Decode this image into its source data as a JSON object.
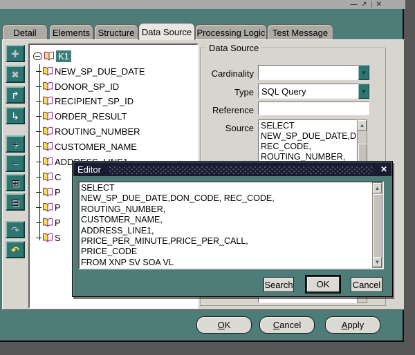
{
  "mdi": {
    "minimize_icon": "—",
    "restore_icon": "↗",
    "close_icon": "✕"
  },
  "tabs": {
    "items": [
      {
        "label": "Detail"
      },
      {
        "label": "Elements"
      },
      {
        "label": "Structure"
      },
      {
        "label": "Data Source"
      },
      {
        "label": "Processing Logic"
      },
      {
        "label": "Test Message"
      }
    ]
  },
  "toolbar": {
    "buttons": [
      {
        "name": "add-node",
        "glyph": "✚"
      },
      {
        "name": "delete-node",
        "glyph": "✖"
      },
      {
        "name": "move-up",
        "glyph": "↱"
      },
      {
        "name": "move-down",
        "glyph": "↳"
      },
      {
        "name": "expand",
        "glyph": "+"
      },
      {
        "name": "collapse",
        "glyph": "−"
      },
      {
        "name": "expand-all",
        "glyph": "⊞"
      },
      {
        "name": "collapse-all",
        "glyph": "⊟"
      },
      {
        "name": "redo",
        "glyph": "↷"
      },
      {
        "name": "undo",
        "glyph": "↶"
      }
    ]
  },
  "tree": {
    "root_label": "K1",
    "items": [
      {
        "label": "NEW_SP_DUE_DATE"
      },
      {
        "label": "DONOR_SP_ID"
      },
      {
        "label": "RECIPIENT_SP_ID"
      },
      {
        "label": "ORDER_RESULT"
      },
      {
        "label": "ROUTING_NUMBER"
      },
      {
        "label": "CUSTOMER_NAME"
      },
      {
        "label": "ADDRESS_LINE1"
      },
      {
        "label": "C"
      },
      {
        "label": "P"
      },
      {
        "label": "P"
      },
      {
        "label": "P"
      },
      {
        "label": "S"
      }
    ]
  },
  "data_source": {
    "legend": "Data Source",
    "cardinality_label": "Cardinality",
    "cardinality_value": "",
    "type_label": "Type",
    "type_value": "SQL Query",
    "reference_label": "Reference",
    "reference_value": "",
    "source_label": "Source",
    "source_text": "SELECT\nNEW_SP_DUE_DATE,DON_CODE,\nREC_CODE,\nROUTING_NUMBER,\nCUSTOMER_NAME,"
  },
  "editor": {
    "title": "Editor",
    "close_icon": "✕",
    "text": "SELECT\nNEW_SP_DUE_DATE,DON_CODE, REC_CODE,\nROUTING_NUMBER,\nCUSTOMER_NAME,\nADDRESS_LINE1,\nPRICE_PER_MINUTE,PRICE_PER_CALL,\nPRICE_CODE\nFROM XNP SV SOA VL",
    "search_label": "Search",
    "ok_label": "OK",
    "cancel_label": "Cancel"
  },
  "footer": {
    "ok_label": "OK",
    "cancel_label": "Cancel",
    "apply_label": "Apply"
  },
  "colors": {
    "window_teal": "#4e7d79",
    "desktop": "#575757",
    "panel": "#d8d5cf",
    "editor_titlebar": "#1a1a31",
    "selection": "#3d7e7a",
    "book_outline": "#8b1f8b"
  }
}
